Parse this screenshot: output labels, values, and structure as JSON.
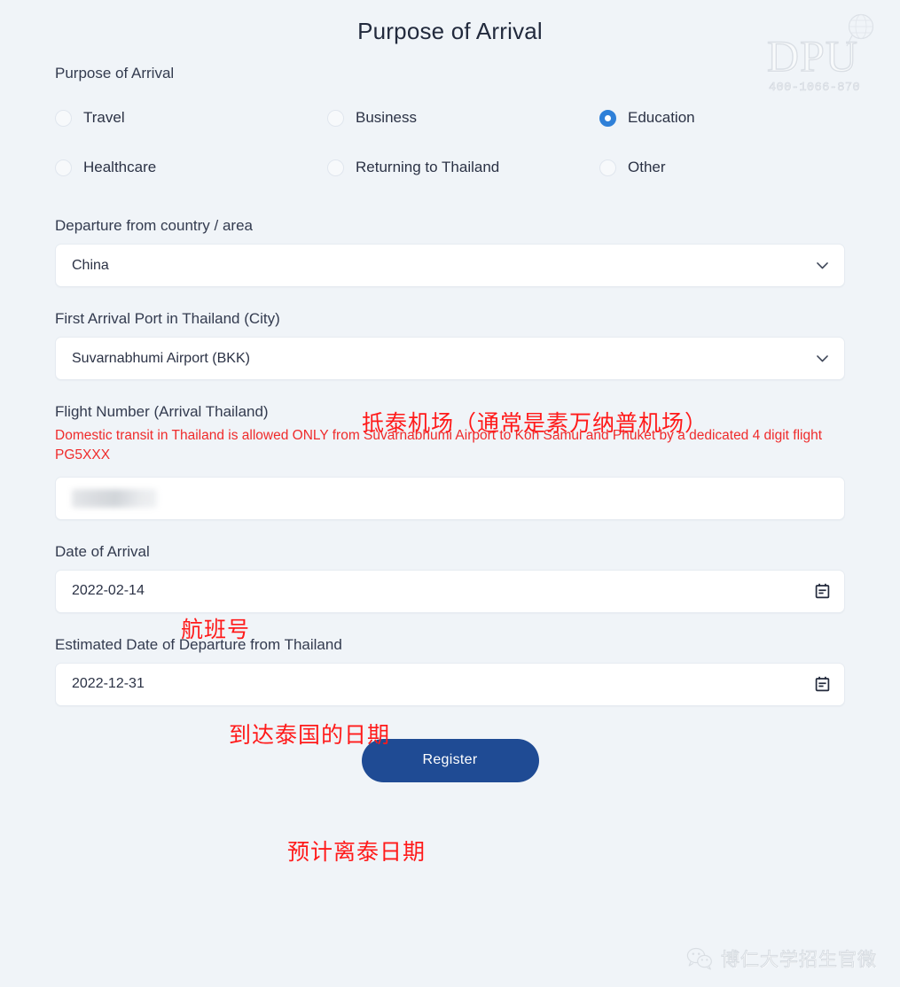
{
  "page": {
    "title": "Purpose of Arrival"
  },
  "logo": {
    "word": "DPU",
    "phone": "400-1066-870",
    "globe_icon": "globe-icon"
  },
  "form": {
    "purpose": {
      "label": "Purpose of Arrival",
      "options": [
        {
          "label": "Travel",
          "selected": false
        },
        {
          "label": "Business",
          "selected": false
        },
        {
          "label": "Education",
          "selected": true
        },
        {
          "label": "Healthcare",
          "selected": false
        },
        {
          "label": "Returning to Thailand",
          "selected": false
        },
        {
          "label": "Other",
          "selected": false
        }
      ]
    },
    "departure_country": {
      "label": "Departure from country / area",
      "value": "China",
      "icon": "chevron-down-icon"
    },
    "arrival_port": {
      "label": "First Arrival Port in Thailand (City)",
      "value": "Suvarnabhumi Airport (BKK)",
      "icon": "chevron-down-icon"
    },
    "flight_number": {
      "label": "Flight Number (Arrival Thailand)",
      "warning": "Domestic transit in Thailand is allowed ONLY from Suvarnabhumi Airport to Koh Samui and Phuket by a dedicated 4 digit flight PG5XXX",
      "value": "",
      "redacted": true
    },
    "date_of_arrival": {
      "label": "Date of Arrival",
      "value": "2022-02-14",
      "icon": "calendar-icon"
    },
    "date_of_departure": {
      "label": "Estimated Date of Departure from Thailand",
      "value": "2022-12-31",
      "icon": "calendar-icon"
    },
    "submit": {
      "label": "Register"
    }
  },
  "annotations": {
    "airport": "抵泰机场（通常是素万纳普机场）",
    "flight": "航班号",
    "arrival_date": "到达泰国的日期",
    "departure_date": "预计离泰日期"
  },
  "watermark": {
    "wechat_icon": "wechat-icon",
    "wechat_text": "博仁大学招生官微"
  },
  "colors": {
    "background": "#f0f4f8",
    "accent_radio": "#2f80d8",
    "button": "#1f4b94",
    "warning": "#ef2b2b",
    "annotation": "#ff1a1a"
  }
}
